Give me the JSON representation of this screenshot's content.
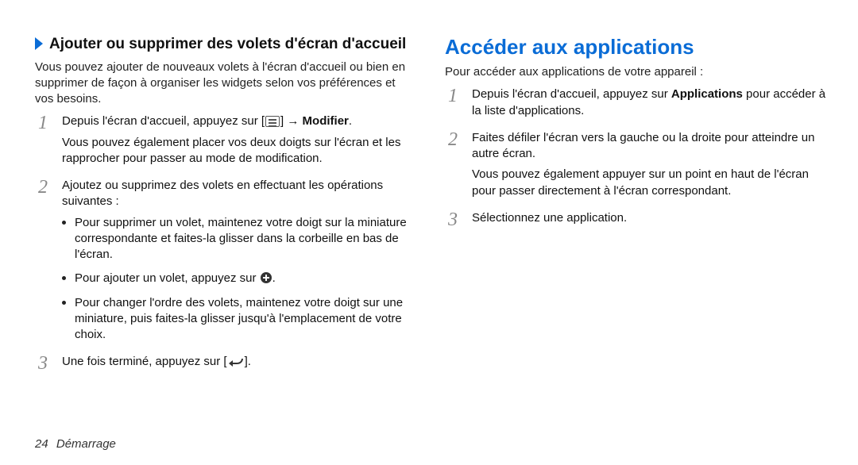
{
  "left": {
    "heading": "Ajouter ou supprimer des volets d'écran d'accueil",
    "intro": "Vous pouvez ajouter de nouveaux volets à l'écran d'accueil ou bien en supprimer de façon à organiser les widgets selon vos préférences et vos besoins.",
    "step1": {
      "prefix": "Depuis l'écran d'accueil, appuyez sur [",
      "suffix": "] → ",
      "bold": "Modifier",
      "end": ".",
      "sub": "Vous pouvez également placer vos deux doigts sur l'écran et les rapprocher pour passer au mode de modification."
    },
    "step2": {
      "text": "Ajoutez ou supprimez des volets en effectuant les opérations suivantes :",
      "bullet1": "Pour supprimer un volet, maintenez votre doigt sur la miniature correspondante et faites-la glisser dans la corbeille en bas de l'écran.",
      "bullet2prefix": "Pour ajouter un volet, appuyez sur ",
      "bullet2suffix": ".",
      "bullet3": "Pour changer l'ordre des volets, maintenez votre doigt sur une miniature, puis faites-la glisser jusqu'à l'emplacement de votre choix."
    },
    "step3": {
      "prefix": "Une fois terminé, appuyez sur [",
      "suffix": "]."
    }
  },
  "right": {
    "heading": "Accéder aux applications",
    "intro": "Pour accéder aux applications de votre appareil :",
    "step1": {
      "prefix": "Depuis l'écran d'accueil, appuyez sur ",
      "bold": "Applications",
      "suffix": " pour accéder à la liste d'applications."
    },
    "step2": {
      "text": "Faites défiler l'écran vers la gauche ou la droite pour atteindre un autre écran.",
      "sub": "Vous pouvez également appuyer sur un point en haut de l'écran pour passer directement à l'écran correspondant."
    },
    "step3": "Sélectionnez une application."
  },
  "footer": {
    "page_number": "24",
    "section": "Démarrage"
  }
}
